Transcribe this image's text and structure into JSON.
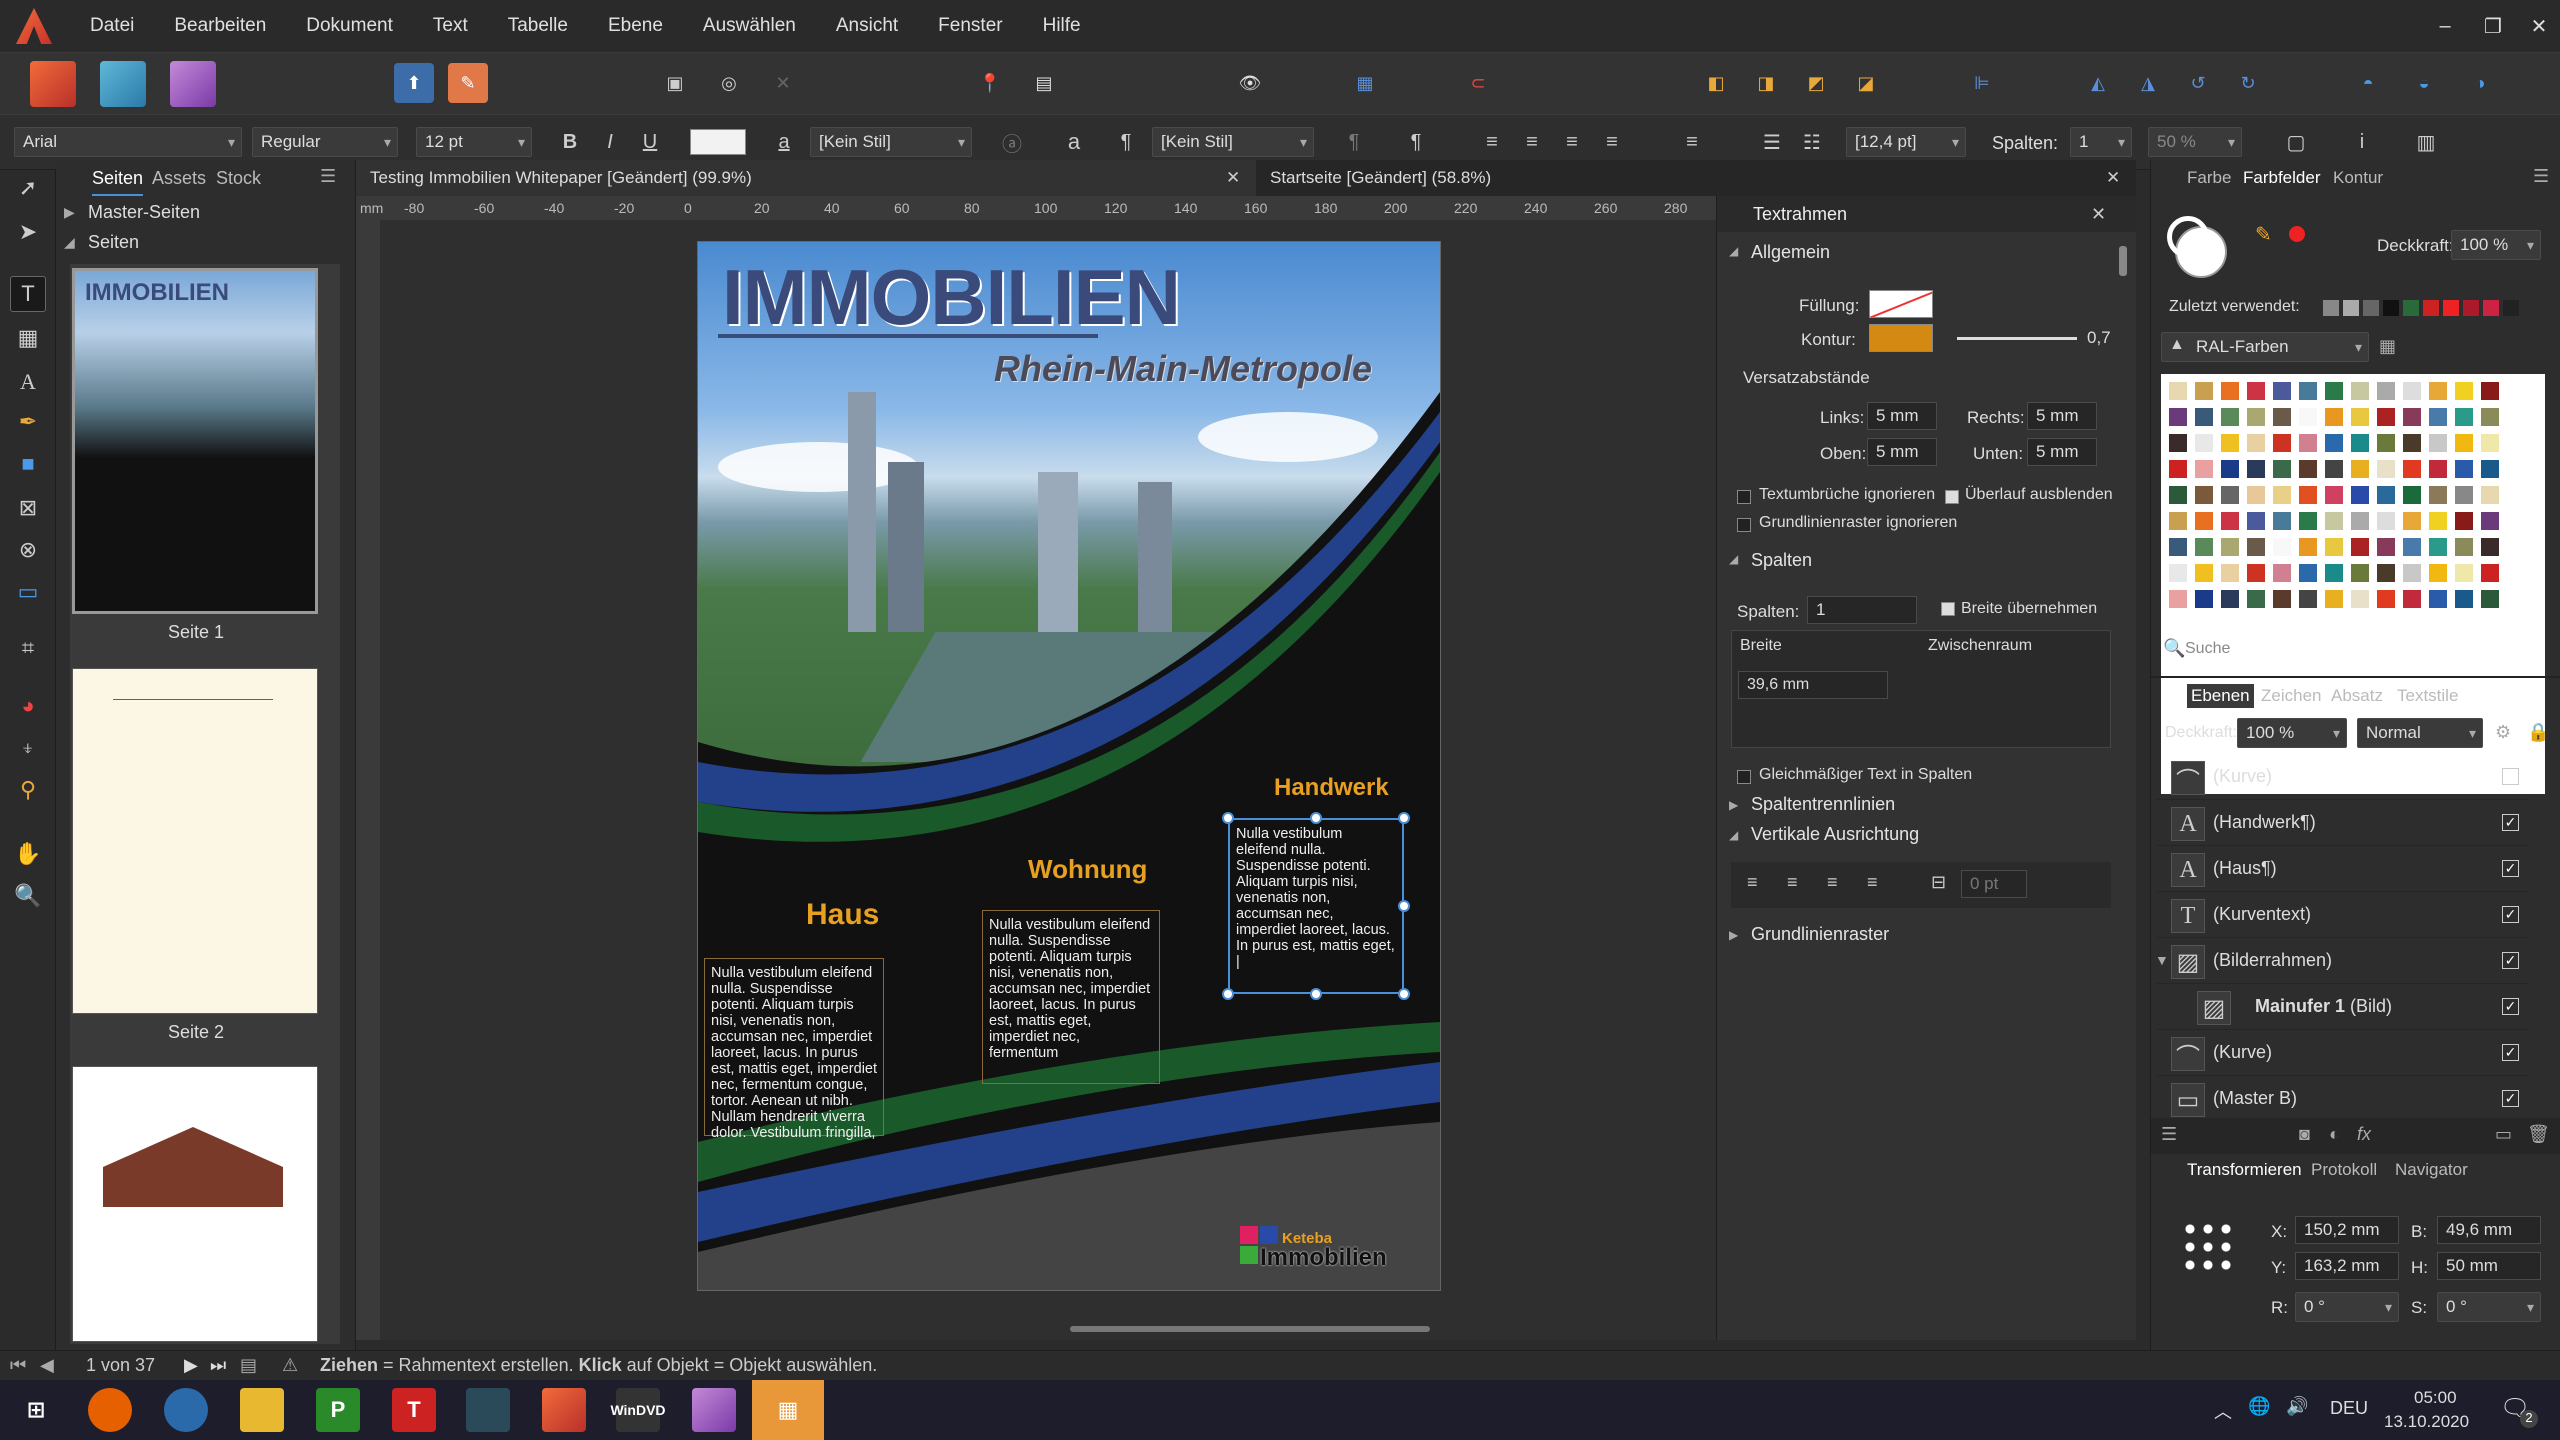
{
  "menu": [
    "Datei",
    "Bearbeiten",
    "Dokument",
    "Text",
    "Tabelle",
    "Ebene",
    "Auswählen",
    "Ansicht",
    "Fenster",
    "Hilfe"
  ],
  "context": {
    "font": "Arial",
    "style": "Regular",
    "size": "12 pt",
    "bold": "B",
    "italic": "I",
    "underline": "U",
    "char_style": "[Kein Stil]",
    "para_style": "[Kein Stil]",
    "leading": "[12,4 pt]",
    "columns_label": "Spalten:",
    "columns_value": "1",
    "zoom_pct": "50 %"
  },
  "left_panel": {
    "tabs": [
      "Seiten",
      "Assets",
      "Stock"
    ],
    "master_pages": "Master-Seiten",
    "pages": "Seiten",
    "page_labels": [
      "Seite 1",
      "Seite 2"
    ]
  },
  "doc_tabs": [
    {
      "title": "Testing Immobilien Whitepaper [Geändert] (99.9%)"
    },
    {
      "title": "Startseite [Geändert] (58.8%)"
    }
  ],
  "ruler_ticks": [
    "-80",
    "-60",
    "-40",
    "-20",
    "0",
    "20",
    "40",
    "60",
    "80",
    "100",
    "120",
    "140",
    "160",
    "180",
    "200",
    "220",
    "240",
    "260",
    "280"
  ],
  "ruler_unit": "mm",
  "page": {
    "title": "IMMOBILIEN",
    "subtitle": "Rhein-Main-Metropole",
    "headings": [
      "Haus",
      "Wohnung",
      "Handwerk"
    ],
    "text_haus": "Nulla vestibulum eleifend nulla. Suspendisse potenti. Aliquam turpis nisi, venenatis non, accumsan nec, imperdiet laoreet, lacus. In purus est, mattis eget, imperdiet nec, fermentum congue, tortor. Aenean ut nibh. Nullam hendrerit viverra dolor. Vestibulum fringilla,",
    "text_wohnung": "Nulla vestibulum eleifend nulla. Suspendisse potenti. Aliquam turpis nisi, venenatis non, accumsan nec, imperdiet laoreet, lacus. In purus est, mattis eget, imperdiet nec, fermentum",
    "text_handwerk": "Nulla vestibulum eleifend nulla. Suspendisse potenti. Aliquam turpis nisi, venenatis non, accumsan nec, imperdiet laoreet, lacus. In purus est, mattis eget, |",
    "logo_line1": "Keteba",
    "logo_line2": "Immobilien"
  },
  "text_panel": {
    "title": "Textrahmen",
    "general": "Allgemein",
    "fill": "Füllung:",
    "stroke": "Kontur:",
    "stroke_width": "0,7",
    "insets": "Versatzabstände",
    "left": "Links:",
    "left_v": "5 mm",
    "right": "Rechts:",
    "right_v": "5 mm",
    "top": "Oben:",
    "top_v": "5 mm",
    "bottom": "Unten:",
    "bottom_v": "5 mm",
    "ignore_wrap": "Textumbrüche ignorieren",
    "hide_overflow": "Überlauf ausblenden",
    "ignore_baseline": "Grundlinienraster ignorieren",
    "columns": "Spalten",
    "columns_lbl": "Spalten:",
    "columns_v": "1",
    "width_take": "Breite übernehmen",
    "width": "Breite",
    "gutter": "Zwischenraum",
    "width_v": "39,6 mm",
    "even_text": "Gleichmäßiger Text in Spalten",
    "column_rules": "Spaltentrennlinien",
    "vertical_align": "Vertikale Ausrichtung",
    "va_value": "0 pt",
    "baseline_grid": "Grundlinienraster"
  },
  "right_panel": {
    "tabs_top": [
      "Farbe",
      "Farbfelder",
      "Kontur"
    ],
    "opacity_lbl": "Deckkraft:",
    "opacity_v": "100 %",
    "recent": "Zuletzt verwendet:",
    "palette": "RAL-Farben",
    "search": "Suche",
    "tabs_mid": [
      "Ebenen",
      "Zeichen",
      "Absatz",
      "Textstile"
    ],
    "layer_opacity_v": "100 %",
    "blend": "Normal",
    "layers": [
      {
        "name": "(Kurve)",
        "icon": "curve-icon"
      },
      {
        "name": "(Handwerk¶)",
        "icon": "text-icon"
      },
      {
        "name": "(Haus¶)",
        "icon": "text-icon"
      },
      {
        "name": "(Kurventext)",
        "icon": "frame-text-icon"
      },
      {
        "name": "(Bilderrahmen)",
        "icon": "image-icon"
      },
      {
        "name": "Mainufer 1",
        "suffix": "(Bild)",
        "icon": "image-icon"
      },
      {
        "name": "(Kurve)",
        "icon": "curve-icon"
      },
      {
        "name": "(Master B)",
        "icon": "master-icon"
      }
    ],
    "tabs_bottom": [
      "Transformieren",
      "Protokoll",
      "Navigator"
    ],
    "x_lbl": "X:",
    "x_v": "150,2 mm",
    "y_lbl": "Y:",
    "y_v": "163,2 mm",
    "w_lbl": "B:",
    "w_v": "49,6 mm",
    "h_lbl": "H:",
    "h_v": "50 mm",
    "r_lbl": "R:",
    "r_v": "0 °",
    "s_lbl": "S:",
    "s_v": "0 °"
  },
  "status": {
    "pages": "1 von 37",
    "hint_bold1": "Ziehen",
    "hint1": " = Rahmentext erstellen. ",
    "hint_bold2": "Klick",
    "hint2": " auf Objekt = Objekt auswählen."
  },
  "taskbar": {
    "lang": "DEU",
    "time": "05:00",
    "date": "13.10.2020",
    "notif": "2"
  },
  "colors": {
    "accent": "#4a90d9",
    "affinity_orange": "#f26b3a",
    "heading_orange": "#e8a020",
    "stroke_orange": "#d48a12"
  }
}
